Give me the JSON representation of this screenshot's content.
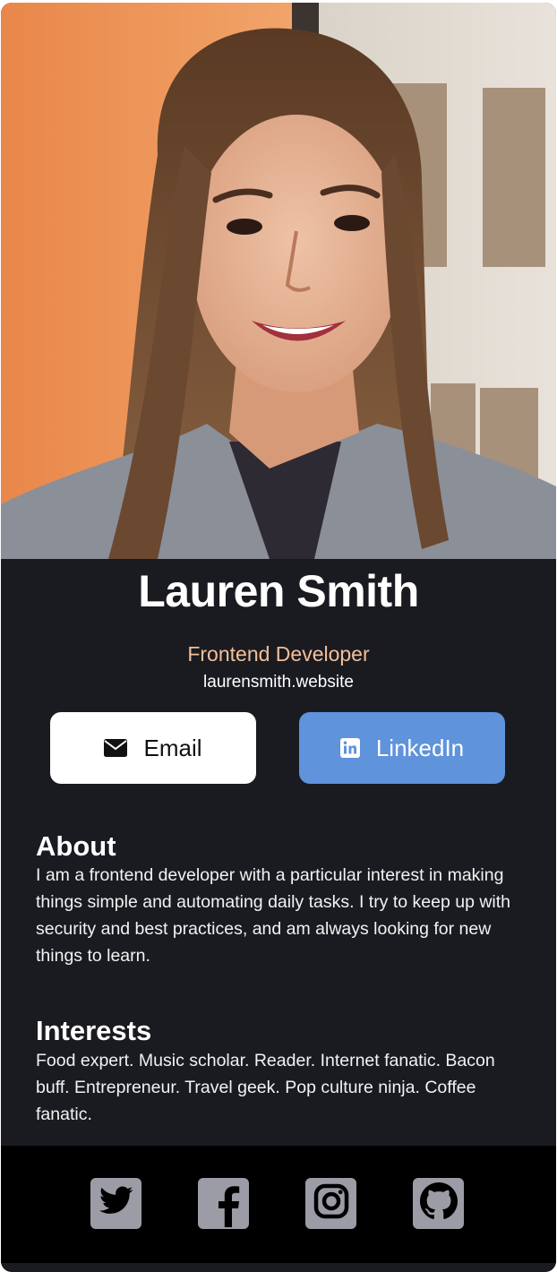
{
  "profile": {
    "name": "Lauren Smith",
    "role": "Frontend Developer",
    "website": "laurensmith.website"
  },
  "buttons": {
    "email_label": "Email",
    "linkedin_label": "LinkedIn"
  },
  "about": {
    "title": "About",
    "text": "I am a frontend developer with a particular interest in making things simple and automating daily tasks. I try to keep up with security and best practices, and am always looking for new things to learn."
  },
  "interests": {
    "title": "Interests",
    "text": "Food expert. Music scholar. Reader. Internet fanatic. Bacon buff. Entrepreneur. Travel geek. Pop culture ninja. Coffee fanatic."
  },
  "footer": {
    "icons": [
      "twitter-icon",
      "facebook-icon",
      "instagram-icon",
      "github-icon"
    ]
  },
  "colors": {
    "card_background": "#1a1b20",
    "role_accent": "#f3bf99",
    "linkedin_button": "#5f93db",
    "footer_background": "#000000",
    "social_icon_bg": "#9c9ca6"
  }
}
